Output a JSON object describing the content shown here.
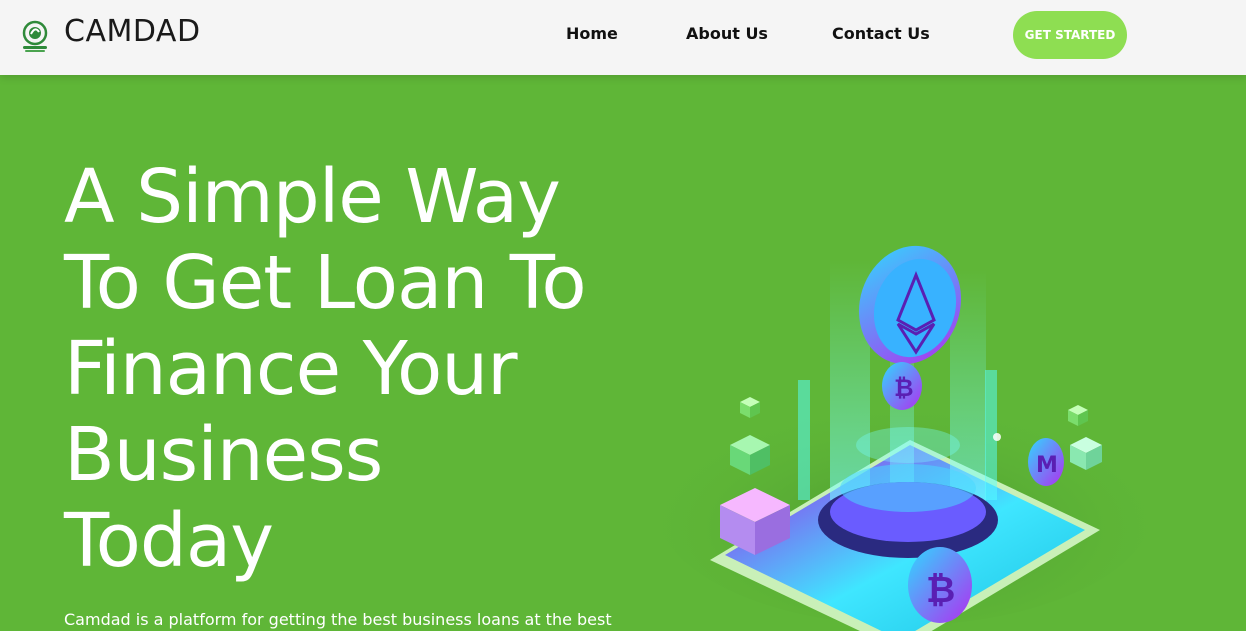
{
  "header": {
    "brand": "CAMDAD",
    "nav": {
      "home": "Home",
      "about": "About Us",
      "contact": "Contact Us"
    },
    "cta_label": "GET STARTED"
  },
  "hero": {
    "title_lines": [
      "A Simple Way",
      "To Get Loan To",
      "Finance Your",
      "Business",
      "Today"
    ],
    "description": "Camdad is a platform for getting the best business loans at the best"
  },
  "colors": {
    "hero_bg": "#5fb637",
    "cta_bg": "#8ede52",
    "header_bg": "#f5f5f5"
  },
  "icons": {
    "logo": "camdad-logo-icon",
    "illustration": "crypto-phone-illustration"
  }
}
